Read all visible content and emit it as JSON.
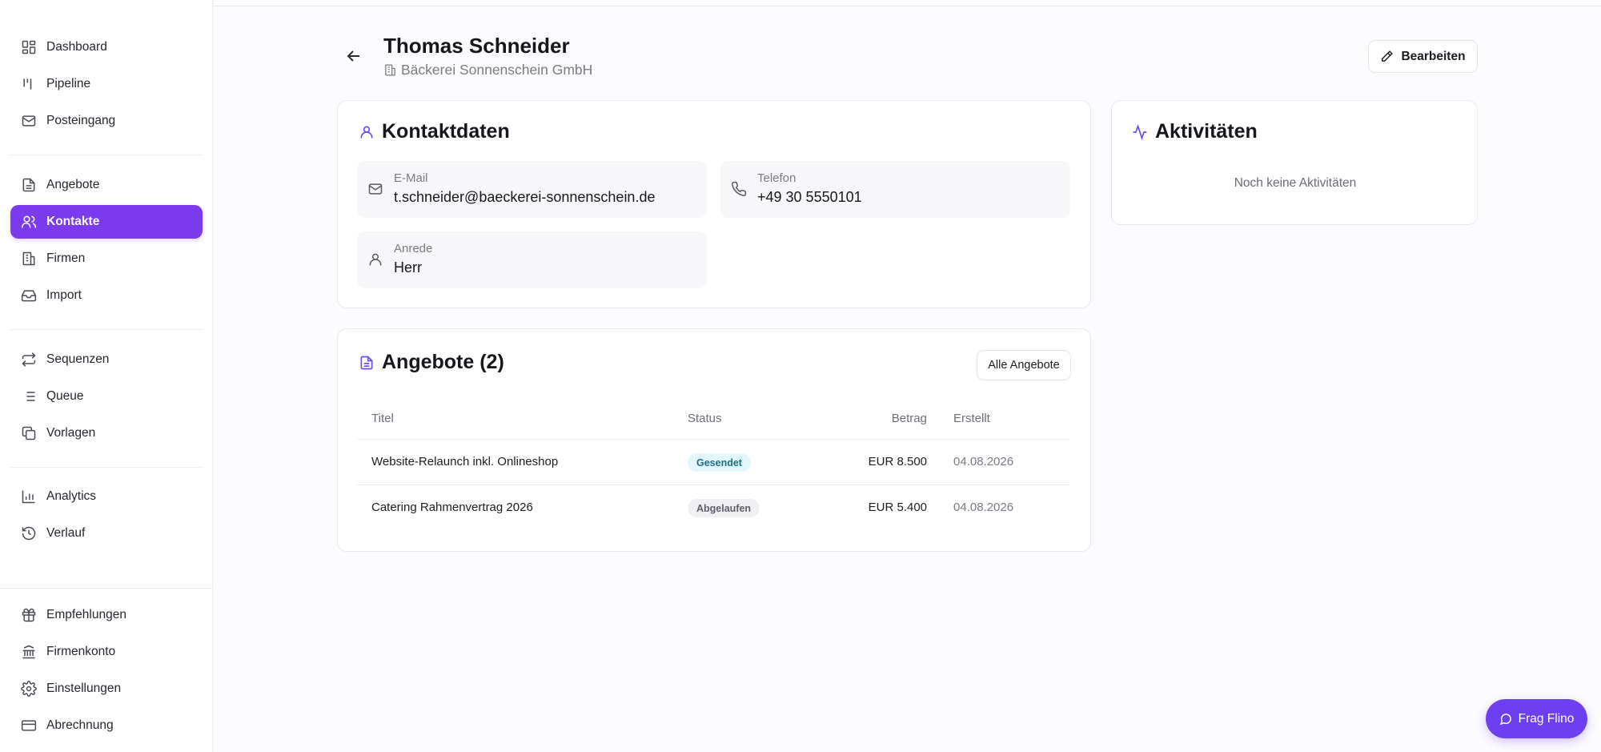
{
  "sidebar": {
    "items": [
      {
        "label": "Dashboard",
        "icon": "dashboard-icon"
      },
      {
        "label": "Pipeline",
        "icon": "pipeline-icon"
      },
      {
        "label": "Posteingang",
        "icon": "mail-icon"
      },
      {
        "label": "Angebote",
        "icon": "document-icon"
      },
      {
        "label": "Kontakte",
        "icon": "users-icon",
        "active": true
      },
      {
        "label": "Firmen",
        "icon": "building-icon"
      },
      {
        "label": "Import",
        "icon": "inbox-icon"
      },
      {
        "label": "Sequenzen",
        "icon": "repeat-icon"
      },
      {
        "label": "Queue",
        "icon": "list-icon"
      },
      {
        "label": "Vorlagen",
        "icon": "copy-icon"
      },
      {
        "label": "Analytics",
        "icon": "bar-chart-icon"
      },
      {
        "label": "Verlauf",
        "icon": "history-icon"
      },
      {
        "label": "Empfehlungen",
        "icon": "gift-icon"
      },
      {
        "label": "Firmenkonto",
        "icon": "bank-icon"
      },
      {
        "label": "Einstellungen",
        "icon": "gear-icon"
      },
      {
        "label": "Abrechnung",
        "icon": "credit-card-icon"
      }
    ]
  },
  "header": {
    "name": "Thomas Schneider",
    "company": "Bäckerei Sonnenschein GmbH",
    "edit_label": "Bearbeiten"
  },
  "contact_card": {
    "title": "Kontaktdaten",
    "email_label": "E-Mail",
    "email_value": "t.schneider@baeckerei-sonnenschein.de",
    "phone_label": "Telefon",
    "phone_value": "+49 30 5550101",
    "salutation_label": "Anrede",
    "salutation_value": "Herr"
  },
  "activity_card": {
    "title": "Aktivitäten",
    "empty_text": "Noch keine Aktivitäten"
  },
  "offers_card": {
    "title": "Angebote (2)",
    "all_button": "Alle Angebote",
    "columns": {
      "title": "Titel",
      "status": "Status",
      "amount": "Betrag",
      "created": "Erstellt"
    },
    "rows": [
      {
        "title": "Website-Relaunch inkl. Onlineshop",
        "status": "Gesendet",
        "amount": "EUR 8.500",
        "created": "04.08.2026"
      },
      {
        "title": "Catering Rahmenvertrag 2026",
        "status": "Abgelaufen",
        "amount": "EUR 5.400",
        "created": "04.08.2026"
      }
    ]
  },
  "assistant": {
    "label": "Frag Flino"
  },
  "colors": {
    "accent": "#7c3aed",
    "assistant": "#6d3ff0",
    "sent_badge": "#e3f6fb",
    "expired_badge": "#f0f0f3"
  }
}
